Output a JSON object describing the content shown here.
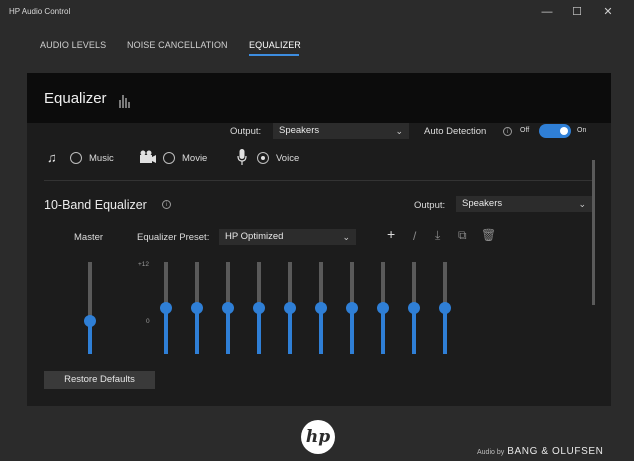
{
  "window": {
    "title": "HP Audio Control",
    "minimize_glyph": "—",
    "maximize_glyph": "☐",
    "close_glyph": "✕"
  },
  "tabs": [
    {
      "label": "AUDIO LEVELS",
      "active": false
    },
    {
      "label": "NOISE CANCELLATION",
      "active": false
    },
    {
      "label": "EQUALIZER",
      "active": true
    }
  ],
  "colors": {
    "accent": "#2f7fd6",
    "background": "#2b2b2b",
    "panel": "#1c1c1c"
  },
  "equalizer": {
    "title": "Equalizer",
    "title_icon": "equalizer-bars-icon",
    "output_label": "Output:",
    "output_value": "Speakers",
    "auto_detection_label": "Auto Detection",
    "toggle_off_label": "Off",
    "toggle_on_label": "On",
    "auto_detection_on": true,
    "modes": [
      {
        "label": "Music",
        "icon": "music-note-icon",
        "selected": false
      },
      {
        "label": "Movie",
        "icon": "movie-camera-icon",
        "selected": false
      },
      {
        "label": "Voice",
        "icon": "microphone-icon",
        "selected": true
      }
    ]
  },
  "band_equalizer": {
    "title": "10-Band Equalizer",
    "output_label": "Output:",
    "output_value": "Speakers",
    "master_label": "Master",
    "preset_label": "Equalizer Preset:",
    "preset_value": "HP Optimized",
    "scale_top": "+12",
    "scale_mid": "0",
    "tools": [
      "add-icon",
      "edit-icon",
      "download-icon",
      "copy-icon",
      "delete-icon"
    ],
    "master_level_fraction": 0.34,
    "band_levels_db": [
      0,
      0,
      0,
      0,
      0,
      0,
      0,
      0,
      0,
      0
    ],
    "restore_label": "Restore Defaults"
  },
  "footer": {
    "logo_text": "hp",
    "audio_by": "Audio by",
    "brand": "BANG & OLUFSEN"
  }
}
